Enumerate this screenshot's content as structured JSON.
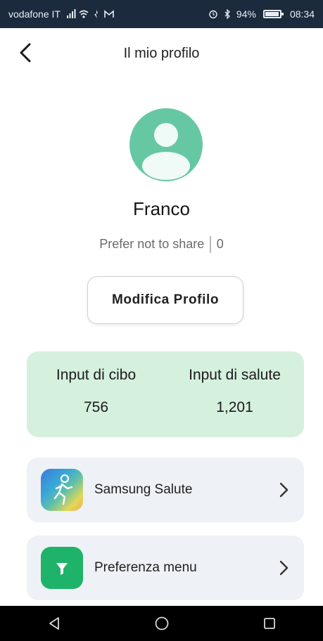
{
  "status_bar": {
    "carrier": "vodafone IT",
    "battery": "94%",
    "battery_level": 0.94,
    "time": "08:34",
    "icons": [
      "signal-icon",
      "wifi-icon",
      "notification-icon",
      "mail-icon",
      "alarm-icon",
      "bluetooth-icon",
      "battery-icon"
    ]
  },
  "header": {
    "title": "Il mio profilo",
    "back_icon": "chevron-left-icon"
  },
  "profile": {
    "avatar_icon": "user-avatar-icon",
    "avatar_color": "#66c8a3",
    "name": "Franco",
    "gender": "Prefer not to share",
    "age": "0",
    "edit_button": "Modifica Profilo"
  },
  "stats": {
    "background": "#d6f0de",
    "items": [
      {
        "label": "Input di cibo",
        "value": "756"
      },
      {
        "label": "Input di salute",
        "value": "1,201"
      }
    ]
  },
  "links": [
    {
      "label": "Samsung Salute",
      "icon": "samsung-health-icon",
      "chevron": "chevron-right-icon"
    },
    {
      "label": "Preferenza menu",
      "icon": "filter-icon",
      "chevron": "chevron-right-icon",
      "icon_color": "#1fb36a"
    }
  ],
  "nav_bar": {
    "buttons": [
      "back-triangle-icon",
      "home-circle-icon",
      "recents-square-icon"
    ]
  }
}
